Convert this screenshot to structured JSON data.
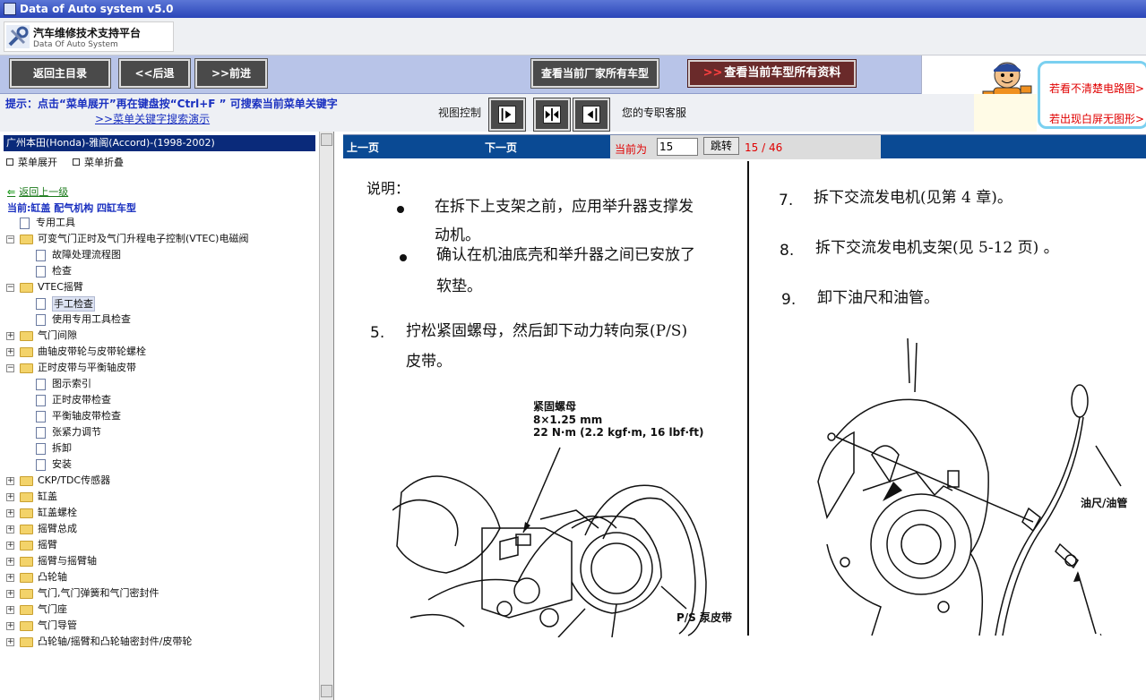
{
  "window": {
    "title": "Data of Auto system v5.0"
  },
  "logo": {
    "title": "汽车维修技术支持平台",
    "subtitle": "Data Of Auto System"
  },
  "toolbar": {
    "home_label": "返回主目录",
    "back_label": "<<后退",
    "forward_label": ">>前进",
    "maker_models_label": "查看当前厂家所有车型",
    "model_all_arrows": ">>",
    "model_all_label": "查看当前车型所有资料"
  },
  "help": {
    "unclear_diagram": "若看不清楚电路图>",
    "white_screen": "若出现白屏无图形>"
  },
  "hint": {
    "text": "提示：点击“菜单展开”再在键盘按“Ctrl+F ” 可搜索当前菜单关键字",
    "link": ">>菜单关键字搜索演示"
  },
  "view_control": {
    "label": "视图控制"
  },
  "service": {
    "label": "您的专职客服"
  },
  "sidebar": {
    "vehicle": "广州本田(Honda)-雅阁(Accord)-(1998-2002)",
    "expand": "菜单展开",
    "collapse": "菜单折叠",
    "back": "返回上一级",
    "current": "当前:缸盖 配气机构 四缸车型",
    "tree": [
      {
        "label": "专用工具",
        "type": "doc",
        "level": 1
      },
      {
        "label": "可变气门正时及气门升程电子控制(VTEC)电磁阀",
        "type": "folder",
        "level": 0,
        "expanded": true
      },
      {
        "label": "故障处理流程图",
        "type": "doc",
        "level": 2
      },
      {
        "label": "检查",
        "type": "doc",
        "level": 2
      },
      {
        "label": "VTEC摇臂",
        "type": "folder",
        "level": 0,
        "expanded": true
      },
      {
        "label": "手工检查",
        "type": "doc",
        "level": 2,
        "selected": true
      },
      {
        "label": "使用专用工具检查",
        "type": "doc",
        "level": 2
      },
      {
        "label": "气门间隙",
        "type": "folder",
        "level": 0
      },
      {
        "label": "曲轴皮带轮与皮带轮螺栓",
        "type": "folder",
        "level": 0
      },
      {
        "label": "正时皮带与平衡轴皮带",
        "type": "folder",
        "level": 0,
        "expanded": true
      },
      {
        "label": "图示索引",
        "type": "doc",
        "level": 2
      },
      {
        "label": "正时皮带检查",
        "type": "doc",
        "level": 2
      },
      {
        "label": "平衡轴皮带检查",
        "type": "doc",
        "level": 2
      },
      {
        "label": "张紧力调节",
        "type": "doc",
        "level": 2
      },
      {
        "label": "拆卸",
        "type": "doc",
        "level": 2
      },
      {
        "label": "安装",
        "type": "doc",
        "level": 2
      },
      {
        "label": "CKP/TDC传感器",
        "type": "folder",
        "level": 0
      },
      {
        "label": "缸盖",
        "type": "folder",
        "level": 0
      },
      {
        "label": "缸盖螺栓",
        "type": "folder",
        "level": 0
      },
      {
        "label": "摇臂总成",
        "type": "folder",
        "level": 0
      },
      {
        "label": "摇臂",
        "type": "folder",
        "level": 0
      },
      {
        "label": "摇臂与摇臂轴",
        "type": "folder",
        "level": 0
      },
      {
        "label": "凸轮轴",
        "type": "folder",
        "level": 0
      },
      {
        "label": "气门,气门弹簧和气门密封件",
        "type": "folder",
        "level": 0
      },
      {
        "label": "气门座",
        "type": "folder",
        "level": 0
      },
      {
        "label": "气门导管",
        "type": "folder",
        "level": 0
      },
      {
        "label": "凸轮轴/摇臂和凸轮轴密封件/皮带轮",
        "type": "folder",
        "level": 0
      }
    ]
  },
  "pager": {
    "prev": "上一页",
    "next": "下一页",
    "current_label": "当前为",
    "page_value": "15",
    "jump": "跳转",
    "page_count": "15 / 46"
  },
  "document": {
    "note_title": "说明：",
    "bullet1_line1": "在拆下上支架之前，应用举升器支撑发",
    "bullet1_line2": "动机。",
    "bullet2_line1": "确认在机油底壳和举升器之间已安放了",
    "bullet2_line2": "软垫。",
    "step5_num": "5.",
    "step5_line1": "拧松紧固螺母，然后卸下动力转向泵(P/S)",
    "step5_line2": "皮带。",
    "fig1_label1": "紧固螺母",
    "fig1_label2": "8×1.25 mm",
    "fig1_label3": "22 N·m (2.2 kgf·m, 16 lbf·ft)",
    "fig1_label4": "P/S  泵皮带",
    "step7_num": "7.",
    "step7": "拆下交流发电机(见第 4 章)。",
    "step8_num": "8.",
    "step8": "拆下交流发电机支架(见 5-12 页) 。",
    "step9_num": "9.",
    "step9": "卸下油尺和油管。",
    "fig2_label": "油尺/油管"
  }
}
